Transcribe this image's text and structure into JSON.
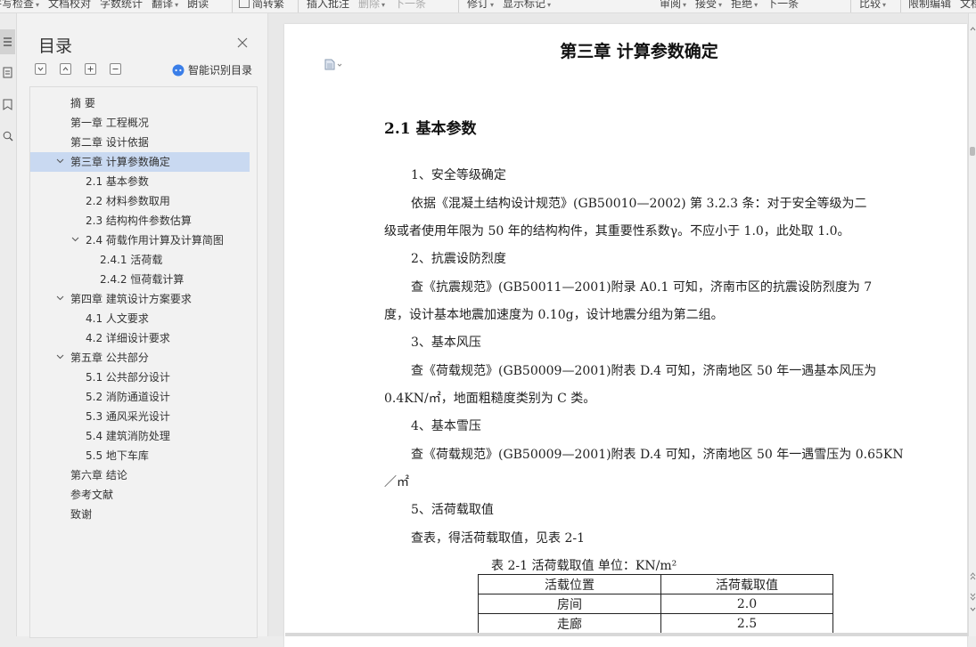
{
  "ribbon": {
    "review_group": [
      {
        "label": "拼写检查",
        "caret": true
      },
      {
        "label": "文档校对"
      },
      {
        "label": "字数统计"
      },
      {
        "label": "翻译",
        "caret": true
      },
      {
        "label": "朗读"
      }
    ],
    "simplified": "简转繁",
    "comment_group": [
      {
        "label": "插入批注"
      },
      {
        "label": "删除",
        "caret": true,
        "disabled": true
      },
      {
        "label": "下一条",
        "disabled": true
      }
    ],
    "track_group": [
      {
        "label": "修订",
        "caret": true
      },
      {
        "label": "显示标记",
        "caret": true
      }
    ],
    "accept_group": [
      {
        "label": "审阅",
        "caret": true
      },
      {
        "label": "接受",
        "caret": true
      },
      {
        "label": "拒绝",
        "caret": true
      },
      {
        "label": "下一条"
      }
    ],
    "compare_group": [
      {
        "label": "比较",
        "caret": true
      }
    ],
    "protect_group": [
      {
        "label": "限制编辑"
      },
      {
        "label": "文档"
      }
    ]
  },
  "toc": {
    "title": "目录",
    "smart_label": "智能识别目录",
    "items": [
      {
        "label": "摘  要",
        "level": 1
      },
      {
        "label": "第一章 工程概况",
        "level": 1
      },
      {
        "label": "第二章 设计依据",
        "level": 1
      },
      {
        "label": "第三章 计算参数确定",
        "level": 1,
        "expanded": true,
        "selected": true
      },
      {
        "label": "2.1 基本参数",
        "level": 2
      },
      {
        "label": "2.2 材料参数取用",
        "level": 2
      },
      {
        "label": "2.3 结构构件参数估算",
        "level": 2
      },
      {
        "label": "2.4 荷载作用计算及计算简图",
        "level": 2,
        "expanded": true
      },
      {
        "label": "2.4.1 活荷载",
        "level": 3
      },
      {
        "label": "2.4.2 恒荷载计算",
        "level": 3
      },
      {
        "label": "第四章 建筑设计方案要求",
        "level": 1,
        "expanded": true
      },
      {
        "label": "4.1 人文要求",
        "level": 2
      },
      {
        "label": "4.2 详细设计要求",
        "level": 2
      },
      {
        "label": "第五章 公共部分",
        "level": 1,
        "expanded": true
      },
      {
        "label": "5.1 公共部分设计",
        "level": 2
      },
      {
        "label": "5.2 消防通道设计",
        "level": 2
      },
      {
        "label": "5.3 通风采光设计",
        "level": 2
      },
      {
        "label": "5.4 建筑消防处理",
        "level": 2
      },
      {
        "label": "5.5 地下车库",
        "level": 2
      },
      {
        "label": "第六章 结论",
        "level": 1
      },
      {
        "label": "参考文献",
        "level": 1
      },
      {
        "label": "致谢",
        "level": 1
      }
    ]
  },
  "document": {
    "chapter_title": "第三章  计算参数确定",
    "section_title": "2.1 基本参数",
    "lines": [
      {
        "text": "1、安全等级确定",
        "indent": true
      },
      {
        "text": "依据《混凝土结构设计规范》(GB50010—2002)  第 3.2.3 条：对于安全等级为二",
        "indent": true
      },
      {
        "text": "级或者使用年限为 50 年的结构构件，其重要性系数γ。不应小于 1.0，此处取 1.0。",
        "indent": false
      },
      {
        "text": "2、抗震设防烈度",
        "indent": true
      },
      {
        "text": "查《抗震规范》(GB50011—2001)附录 A0.1 可知，济南市区的抗震设防烈度为 7",
        "indent": true
      },
      {
        "text": "度，设计基本地震加速度为 0.10g，设计地震分组为第二组。",
        "indent": false
      },
      {
        "text": "3、基本风压",
        "indent": true
      },
      {
        "text": "查《荷载规范》(GB50009—2001)附表 D.4 可知，济南地区 50 年一遇基本风压为",
        "indent": true
      },
      {
        "text": "0.4KN/㎡，地面粗糙度类别为 C 类。",
        "indent": false
      },
      {
        "text": "4、基本雪压",
        "indent": true
      },
      {
        "text": "查《荷载规范》(GB50009—2001)附表 D.4 可知，济南地区 50 年一遇雪压为 0.65KN",
        "indent": true
      },
      {
        "text": "／㎡",
        "indent": false
      },
      {
        "text": "5、活荷载取值",
        "indent": true
      },
      {
        "text": "查表，得活荷载取值，见表 2-1",
        "indent": true
      }
    ],
    "table_caption": "表 2-1    活荷载取值      单位：KN/m²",
    "table": {
      "headers": [
        "活载位置",
        "活荷载取值"
      ],
      "rows": [
        [
          "房间",
          "2.0"
        ],
        [
          "走廊",
          "2.5"
        ]
      ]
    }
  }
}
